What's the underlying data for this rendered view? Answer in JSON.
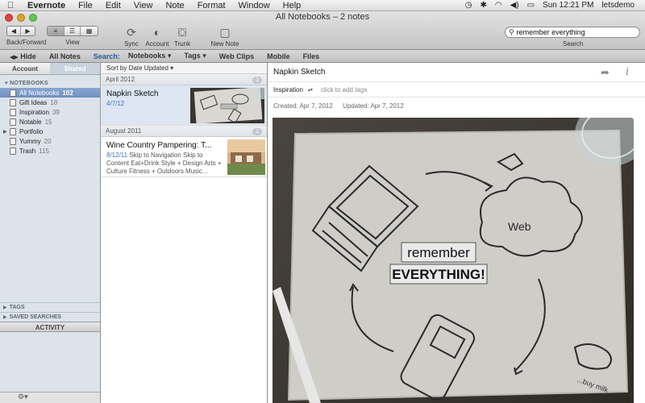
{
  "menubar": {
    "app": "Evernote",
    "items": [
      "File",
      "Edit",
      "View",
      "Note",
      "Format",
      "Window",
      "Help"
    ],
    "clock": "Sun 12:21 PM",
    "user": "letsdemo"
  },
  "window": {
    "title": "All Notebooks – 2 notes"
  },
  "toolbar": {
    "back_forward": "Back/Forward",
    "view": "View",
    "sync": "Sync",
    "account": "Account",
    "trunk": "Trunk",
    "new_note": "New Note",
    "search_value": "remember everything",
    "search_label": "Search"
  },
  "filterbar": {
    "hide": "Hide",
    "all_notes": "All Notes",
    "search": "Search:",
    "notebooks": "Notebooks ▾",
    "tags": "Tags ▾",
    "web_clips": "Web Clips",
    "mobile": "Mobile",
    "files": "Files"
  },
  "sidebar": {
    "tab_account": "Account",
    "tab_shared": "Shared",
    "section_notebooks": "NOTEBOOKS",
    "notebooks": [
      {
        "name": "All Notebooks",
        "count": "102"
      },
      {
        "name": "Gift Ideas",
        "count": "18"
      },
      {
        "name": "Inspiration",
        "count": "39"
      },
      {
        "name": "Notable",
        "count": "15"
      },
      {
        "name": "Portfolio",
        "count": ""
      },
      {
        "name": "Yummy",
        "count": "20"
      },
      {
        "name": "Trash",
        "count": "115"
      }
    ],
    "tags": "TAGS",
    "saved_searches": "SAVED SEARCHES",
    "activity": "ACTIVITY"
  },
  "notelist": {
    "sort": "Sort by Date Updated ▾",
    "groups": [
      {
        "label": "April 2012",
        "count": "1"
      },
      {
        "label": "August 2011",
        "count": "1"
      }
    ],
    "notes": [
      {
        "title": "Napkin Sketch",
        "date": "4/7/12",
        "snippet": ""
      },
      {
        "title": "Wine Country Pampering: T...",
        "date": "8/12/11",
        "snippet": "Skip to Navigation Skip to Content Eat+Drink Style + Design Arts + Culture Fitness + Outdoors Music..."
      }
    ]
  },
  "detail": {
    "title": "Napkin Sketch",
    "notebook": "Inspiration",
    "tags_placeholder": "click to add tags",
    "created": "Created: Apr 7, 2012",
    "updated": "Updated: Apr 7, 2012",
    "image_text": {
      "line1": "remember",
      "line2": "EVERYTHING!",
      "cloud": "Web",
      "corner": "...buy milk"
    }
  },
  "colors": {
    "selection": "#6e8fc0",
    "date_blue": "#3a76c0",
    "sidebar_bg": "#dde3ea"
  }
}
